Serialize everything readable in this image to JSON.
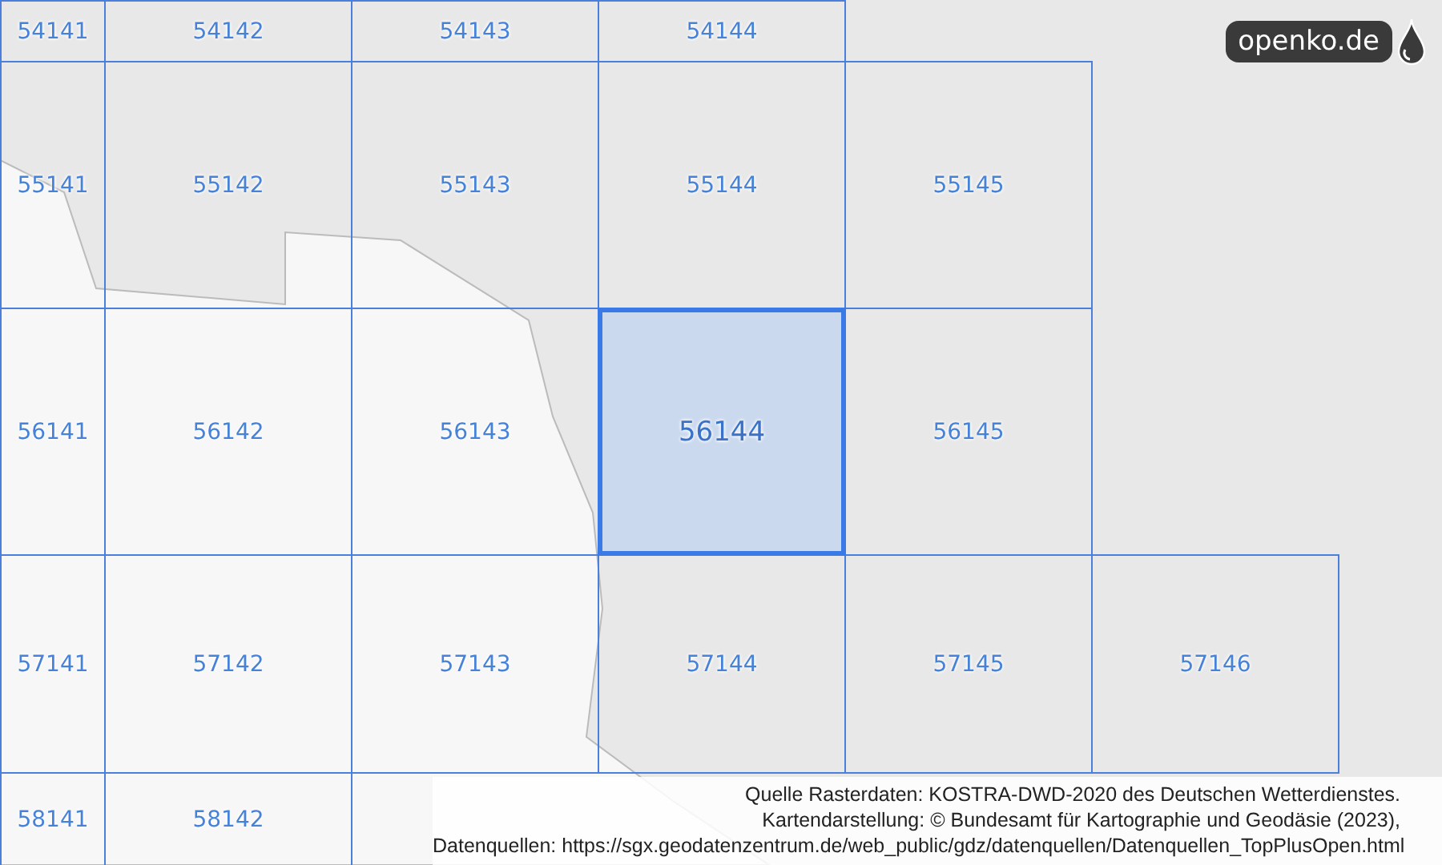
{
  "map": {
    "grid_rows": [
      {
        "cells": [
          {
            "label": "54141",
            "selected": false
          },
          {
            "label": "54142",
            "selected": false
          },
          {
            "label": "54143",
            "selected": false
          },
          {
            "label": "54144",
            "selected": false
          }
        ]
      },
      {
        "cells": [
          {
            "label": "55141",
            "selected": false
          },
          {
            "label": "55142",
            "selected": false
          },
          {
            "label": "55143",
            "selected": false
          },
          {
            "label": "55144",
            "selected": false
          },
          {
            "label": "55145",
            "selected": false
          }
        ]
      },
      {
        "cells": [
          {
            "label": "56141",
            "selected": false
          },
          {
            "label": "56142",
            "selected": false
          },
          {
            "label": "56143",
            "selected": false
          },
          {
            "label": "56144",
            "selected": true
          },
          {
            "label": "56145",
            "selected": false
          }
        ]
      },
      {
        "cells": [
          {
            "label": "57141",
            "selected": false
          },
          {
            "label": "57142",
            "selected": false
          },
          {
            "label": "57143",
            "selected": false
          },
          {
            "label": "57144",
            "selected": false
          },
          {
            "label": "57145",
            "selected": false
          },
          {
            "label": "57146",
            "selected": false
          }
        ]
      },
      {
        "cells": [
          {
            "label": "58141",
            "selected": false
          },
          {
            "label": "58142",
            "selected": false
          }
        ]
      }
    ]
  },
  "logo": {
    "text": "openko.de"
  },
  "attribution": [
    "Quelle Rasterdaten: KOSTRA-DWD-2020 des Deutschen Wetterdienstes.",
    "Kartendarstellung: © Bundesamt für Kartographie und Geodäsie (2023),",
    "Datenquellen: https://sgx.geodatenzentrum.de/web_public/gdz/datenquellen/Datenquellen_TopPlusOpen.html"
  ]
}
